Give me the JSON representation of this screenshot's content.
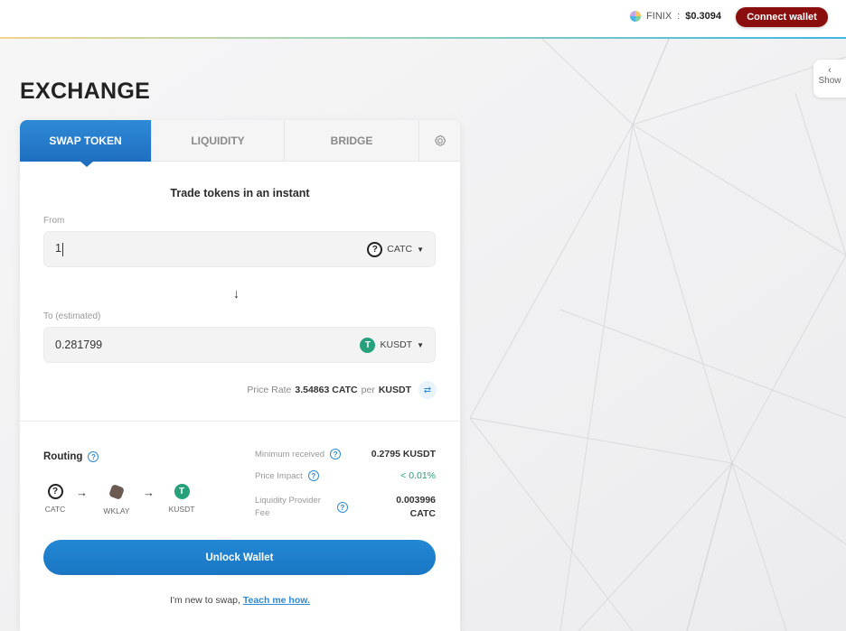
{
  "header": {
    "token_name": "FINIX",
    "token_price": "$0.3094",
    "connect_label": "Connect wallet"
  },
  "side_tab": {
    "label": "Show"
  },
  "page_title": "EXCHANGE",
  "tabs": [
    {
      "label": "SWAP TOKEN",
      "active": true
    },
    {
      "label": "LIQUIDITY",
      "active": false
    },
    {
      "label": "BRIDGE",
      "active": false
    }
  ],
  "swap": {
    "title": "Trade tokens in an instant",
    "from": {
      "label": "From",
      "value": "1",
      "token": "CATC"
    },
    "to": {
      "label": "To (estimated)",
      "value": "0.281799",
      "token": "KUSDT"
    },
    "price_rate": {
      "label": "Price Rate",
      "value": "3.54863 CATC",
      "per": "per",
      "quote": "KUSDT"
    }
  },
  "routing": {
    "label": "Routing",
    "path": [
      "CATC",
      "WKLAY",
      "KUSDT"
    ]
  },
  "stats": {
    "min_received_label": "Minimum received",
    "min_received_value": "0.2795 KUSDT",
    "price_impact_label": "Price Impact",
    "price_impact_value": "< 0.01%",
    "lp_fee_label_1": "Liquidity Provider",
    "lp_fee_label_2": "Fee",
    "lp_fee_value_1": "0.003996",
    "lp_fee_value_2": "CATC"
  },
  "unlock_label": "Unlock Wallet",
  "footer": {
    "text": "I'm new to swap,",
    "link": "Teach me how."
  },
  "colors": {
    "accent": "#1f6fc0",
    "connect": "#8a0e0e",
    "positive": "#26a17b"
  }
}
